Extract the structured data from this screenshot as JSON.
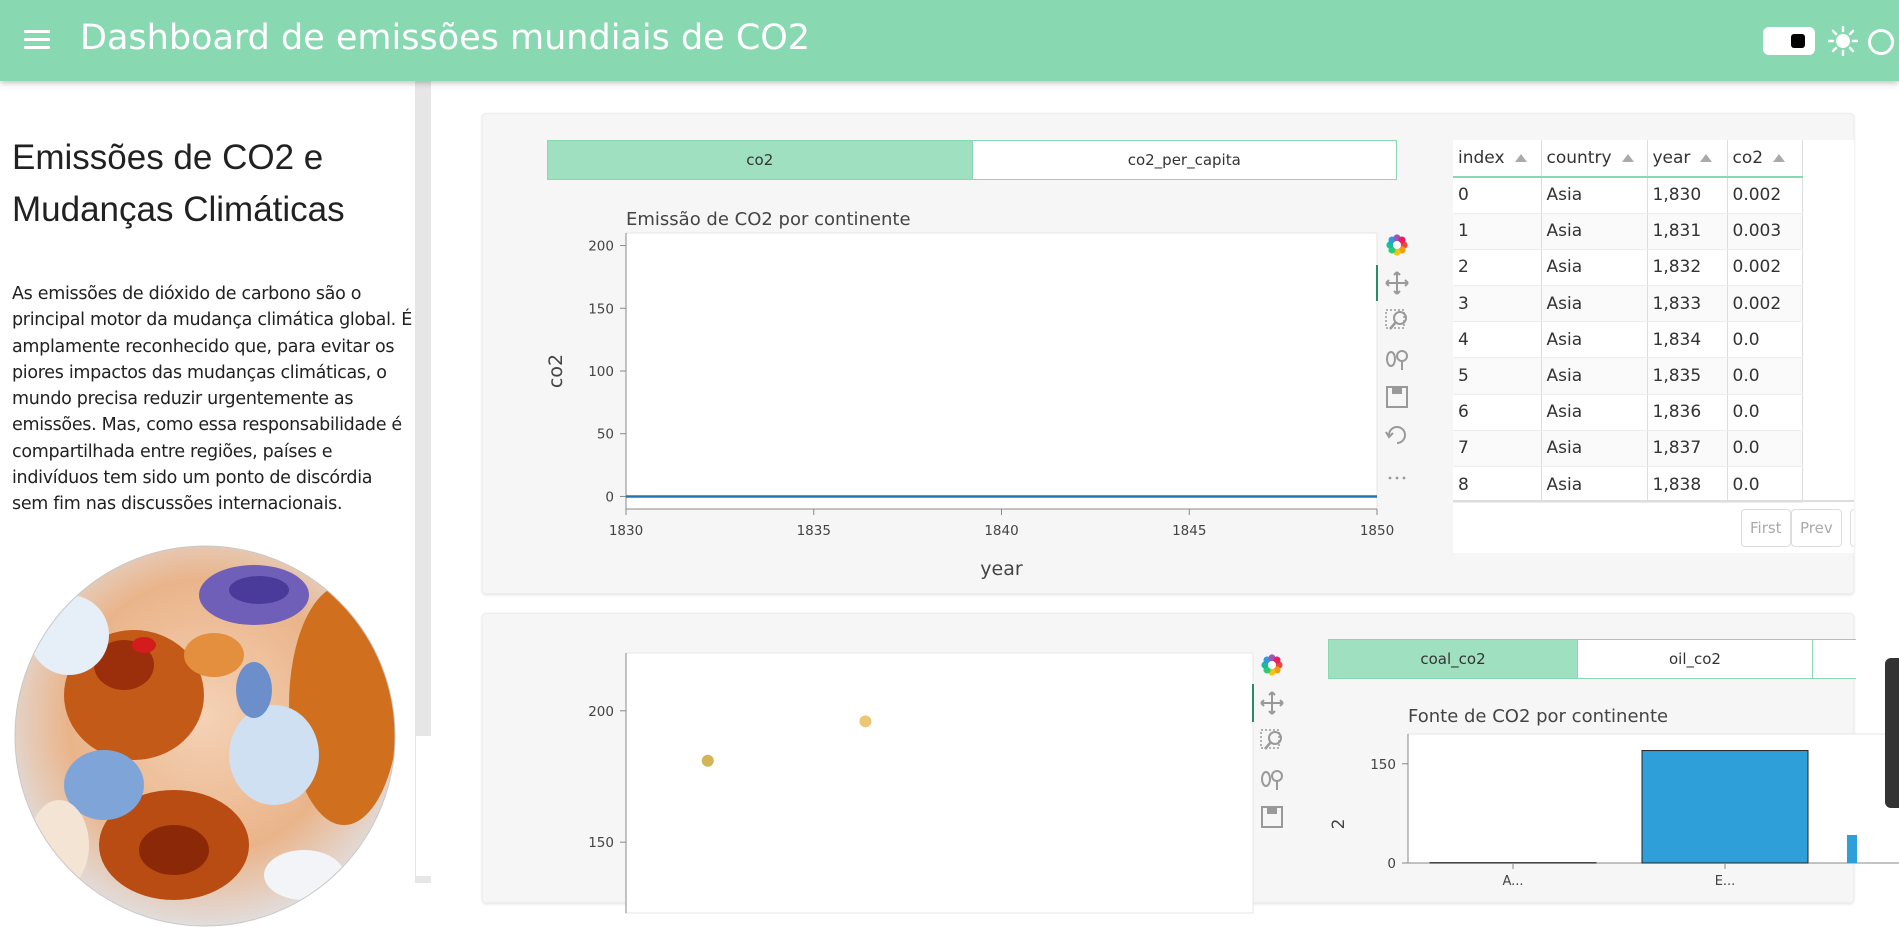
{
  "header": {
    "title": "Dashboard de emissões mundiais de CO2",
    "background": "#88d9b1",
    "icons": [
      "menu-icon",
      "theme-toggle",
      "sun-icon",
      "circle-icon"
    ]
  },
  "sidebar": {
    "heading": "Emissões de CO2 e Mudanças Climáticas",
    "paragraph": "As emissões de dióxido de carbono são o principal motor da mudança climática global. É amplamente reconhecido que, para evitar os piores impactos das mudanças climáticas, o mundo precisa reduzir urgentemente as emissões. Mas, como essa responsabilidade é compartilhada entre regiões, países e indivíduos tem sido um ponto de discórdia sem fim nas discussões internacionais.",
    "image": "globe-temperature-anomaly-map"
  },
  "card1": {
    "tabs": [
      {
        "label": "co2",
        "active": true
      },
      {
        "label": "co2_per_capita",
        "active": false
      }
    ],
    "table": {
      "columns": [
        "index",
        "country",
        "year",
        "co2"
      ],
      "rows": [
        [
          "0",
          "Asia",
          "1,830",
          "0.002"
        ],
        [
          "1",
          "Asia",
          "1,831",
          "0.003"
        ],
        [
          "2",
          "Asia",
          "1,832",
          "0.002"
        ],
        [
          "3",
          "Asia",
          "1,833",
          "0.002"
        ],
        [
          "4",
          "Asia",
          "1,834",
          "0.0"
        ],
        [
          "5",
          "Asia",
          "1,835",
          "0.0"
        ],
        [
          "6",
          "Asia",
          "1,836",
          "0.0"
        ],
        [
          "7",
          "Asia",
          "1,837",
          "0.0"
        ],
        [
          "8",
          "Asia",
          "1,838",
          "0.0"
        ]
      ],
      "pager": {
        "first": "First",
        "prev": "Prev"
      }
    }
  },
  "card2": {
    "tabs": [
      {
        "label": "coal_co2",
        "active": true
      },
      {
        "label": "oil_co2",
        "active": false
      }
    ]
  },
  "toolbar_icons": [
    "bokeh-logo-icon",
    "pan-icon",
    "box-zoom-icon",
    "wheel-zoom-icon",
    "save-icon",
    "reset-icon",
    "more-icon"
  ],
  "chart_data": [
    {
      "type": "line",
      "title": "Emissão de CO2 por continente",
      "xlabel": "year",
      "ylabel": "co2",
      "xlim": [
        1830,
        1850
      ],
      "ylim": [
        -10,
        210
      ],
      "xticks": [
        1830,
        1835,
        1840,
        1845,
        1850
      ],
      "yticks": [
        0,
        50,
        100,
        150,
        200
      ],
      "series": [
        {
          "x": [
            1830,
            1831,
            1832,
            1833,
            1834,
            1835,
            1836,
            1837,
            1838,
            1839,
            1840,
            1841,
            1842,
            1843,
            1844,
            1845,
            1846,
            1847,
            1848,
            1849,
            1850
          ],
          "values": [
            0.002,
            0.003,
            0.002,
            0.002,
            0,
            0,
            0,
            0,
            0,
            0,
            0,
            0,
            0,
            0,
            0,
            0,
            0,
            0,
            0,
            0,
            0
          ],
          "color": "#1f77b4"
        }
      ],
      "grid": false
    },
    {
      "type": "scatter",
      "title": "",
      "ylim": [
        120,
        222
      ],
      "yticks": [
        150,
        200
      ],
      "points": [
        {
          "x": 0.14,
          "y": 181,
          "color": "#c9a83a"
        },
        {
          "x": 0.41,
          "y": 196,
          "color": "#e8bc5c"
        }
      ]
    },
    {
      "type": "bar",
      "title": "Fonte de CO2 por continente",
      "ylabel": "2",
      "ylim": [
        0,
        195
      ],
      "yticks": [
        0,
        150
      ],
      "categories": [
        "Asia",
        "Europe"
      ],
      "tick_labels": [
        "A...",
        "E..."
      ],
      "values": [
        0.5,
        170
      ],
      "color": "#2e9fd8"
    }
  ]
}
